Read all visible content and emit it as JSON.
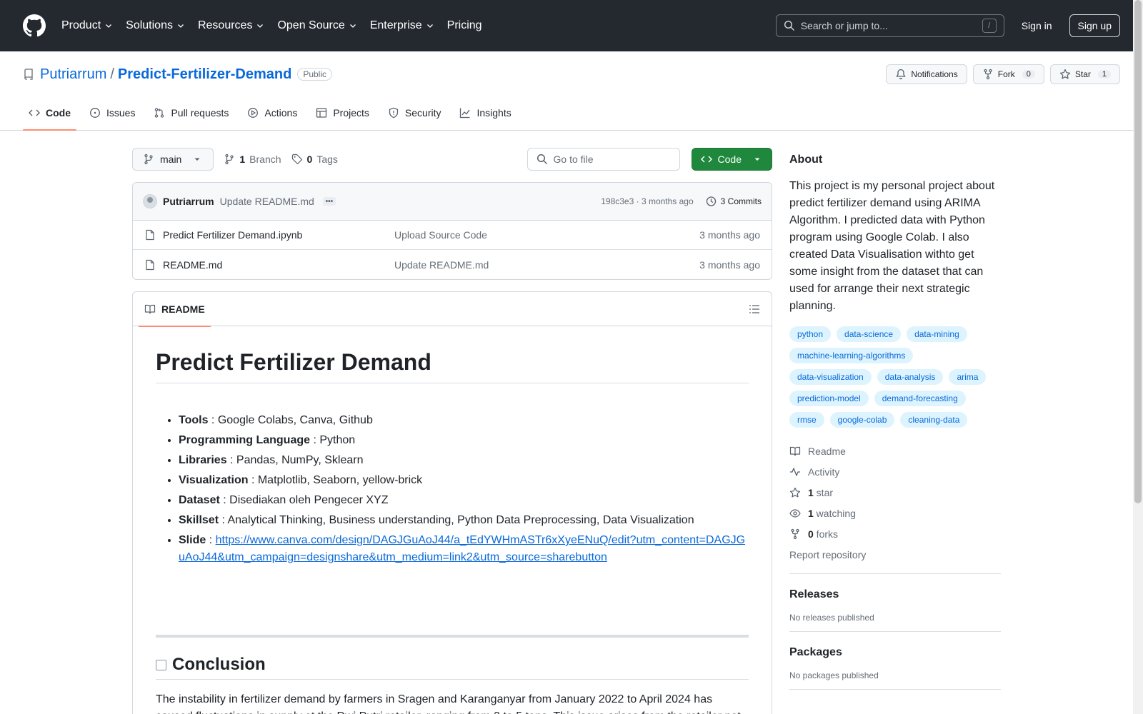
{
  "header": {
    "nav": [
      "Product",
      "Solutions",
      "Resources",
      "Open Source",
      "Enterprise",
      "Pricing"
    ],
    "search_placeholder": "Search or jump to...",
    "search_key": "/",
    "sign_in": "Sign in",
    "sign_up": "Sign up"
  },
  "repo": {
    "owner": "Putriarrum",
    "separator": "/",
    "name": "Predict-Fertilizer-Demand",
    "visibility": "Public",
    "notifications_label": "Notifications",
    "fork_label": "Fork",
    "fork_count": "0",
    "star_label": "Star",
    "star_count": "1"
  },
  "tabs": [
    "Code",
    "Issues",
    "Pull requests",
    "Actions",
    "Projects",
    "Security",
    "Insights"
  ],
  "file_nav": {
    "branch": "main",
    "branch_count": "1",
    "branch_label": "Branch",
    "tag_count": "0",
    "tag_label": "Tags",
    "goto_placeholder": "Go to file",
    "code_button": "Code"
  },
  "latest_commit": {
    "author": "Putriarrum",
    "message": "Update README.md",
    "ellipsis": "•••",
    "hash_time": "198c3e3 · 3 months ago",
    "commits": "3 Commits"
  },
  "files": [
    {
      "name": "Predict Fertilizer Demand.ipynb",
      "message": "Upload Source Code",
      "time": "3 months ago"
    },
    {
      "name": "README.md",
      "message": "Update README.md",
      "time": "3 months ago"
    }
  ],
  "readme": {
    "tab": "README",
    "title": "Predict Fertilizer Demand",
    "items": [
      {
        "key": "Tools",
        "value": " : Google Colabs, Canva, Github"
      },
      {
        "key": "Programming Language",
        "value": " : Python"
      },
      {
        "key": "Libraries",
        "value": " : Pandas, NumPy, Sklearn"
      },
      {
        "key": "Visualization",
        "value": " : Matplotlib, Seaborn, yellow-brick"
      },
      {
        "key": "Dataset",
        "value": " : Disediakan oleh Pengecer XYZ"
      },
      {
        "key": "Skillset",
        "value": " : Analytical Thinking, Business understanding, Python Data Preprocessing, Data Visualization"
      }
    ],
    "slide_key": "Slide",
    "slide_sep": " : ",
    "slide_url": "https://www.canva.com/design/DAGJGuAoJ44/a_tEdYWHmASTr6xXyeENuQ/edit?utm_content=DAGJGuAoJ44&utm_campaign=designshare&utm_medium=link2&utm_source=sharebutton",
    "conclusion_title": "Conclusion",
    "conclusion_text": "The instability in fertilizer demand by farmers in Sragen and Karanganyar from January 2022 to April 2024 has caused fluctuations in supply at the Dwi Putri retailer, ranging from 3 to 5 tons. This issue arises from the retailer not"
  },
  "about": {
    "title": "About",
    "description": "This project is my personal project about predict fertilizer demand using ARIMA Algorithm. I predicted data with Python program using Google Colab. I also created Data Visualisation withto get some insight from the dataset that can used for arrange their next strategic planning.",
    "topics": [
      "python",
      "data-science",
      "data-mining",
      "machine-learning-algorithms",
      "data-visualization",
      "data-analysis",
      "arima",
      "prediction-model",
      "demand-forecasting",
      "rmse",
      "google-colab",
      "cleaning-data"
    ],
    "readme_link": "Readme",
    "activity_link": "Activity",
    "stars_count": "1",
    "stars_label": " star",
    "watching_count": "1",
    "watching_label": " watching",
    "forks_count": "0",
    "forks_label": " forks",
    "report": "Report repository"
  },
  "releases": {
    "title": "Releases",
    "text": "No releases published"
  },
  "packages": {
    "title": "Packages",
    "text": "No packages published"
  },
  "colors": {
    "accent_blue": "#0969da",
    "green": "#1f883d",
    "header_bg": "#24292f",
    "tab_underline": "#fd8c73",
    "topic_bg": "#ddf4ff"
  }
}
